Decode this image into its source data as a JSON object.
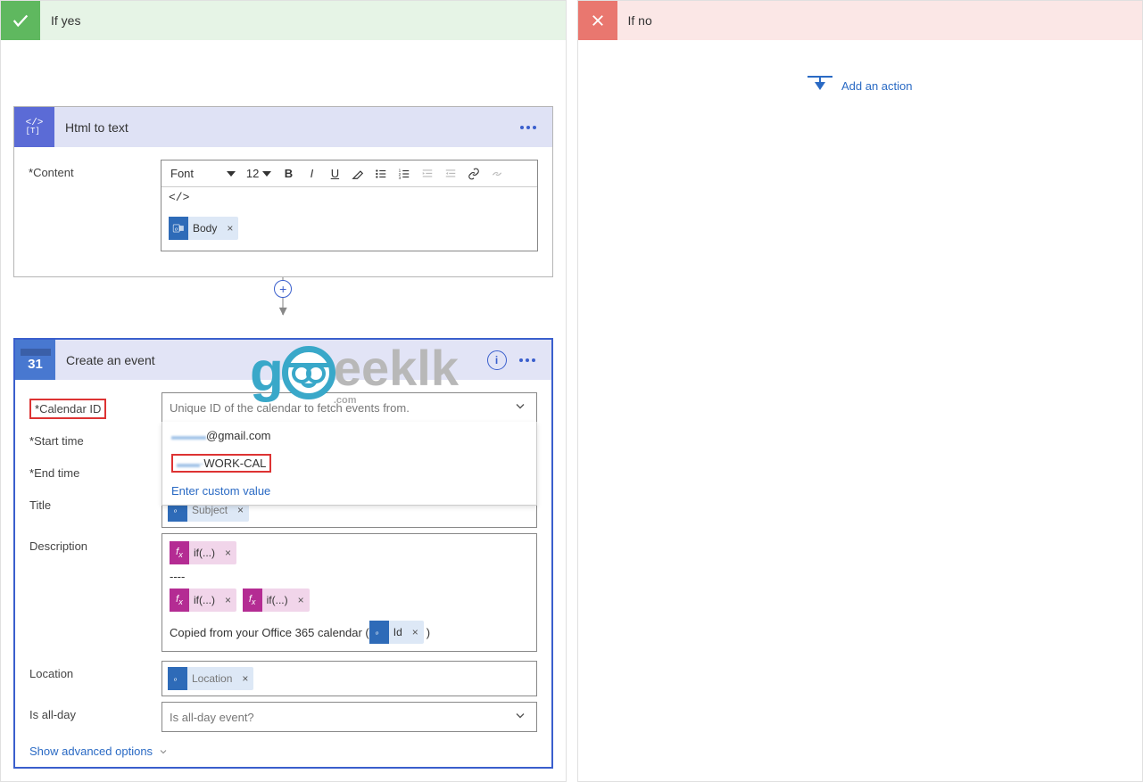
{
  "branches": {
    "yes": {
      "label": "If yes"
    },
    "no": {
      "label": "If no",
      "add_action": "Add an action"
    }
  },
  "html_to_text": {
    "title": "Html to text",
    "content_label": "Content",
    "toolbar": {
      "font": "Font",
      "size": "12",
      "bold": "B",
      "italic": "I",
      "underline": "U"
    },
    "editor_text": "</>",
    "body_tag": "Body"
  },
  "create_event": {
    "title": "Create an event",
    "info": "i",
    "fields": {
      "calendar_id": {
        "label": "Calendar ID",
        "placeholder": "Unique ID of the calendar to fetch events from."
      },
      "start_time": {
        "label": "Start time"
      },
      "end_time": {
        "label": "End time"
      },
      "title": {
        "label": "Title",
        "tag": "Subject"
      },
      "description": {
        "label": "Description",
        "fx": "if(...)",
        "dashes": "----",
        "copied_text": "Copied from your Office 365 calendar (",
        "id_tag": "Id",
        "close_paren": ")"
      },
      "location": {
        "label": "Location",
        "tag": "Location"
      },
      "all_day": {
        "label": "Is all-day",
        "placeholder": "Is all-day event?"
      }
    },
    "dropdown": {
      "option1": "@gmail.com",
      "option2": "WORK-CAL",
      "custom": "Enter custom value"
    },
    "advanced": "Show advanced options"
  },
  "watermark": {
    "text1": "g",
    "text2": "eeklk",
    "sub": ".com"
  }
}
